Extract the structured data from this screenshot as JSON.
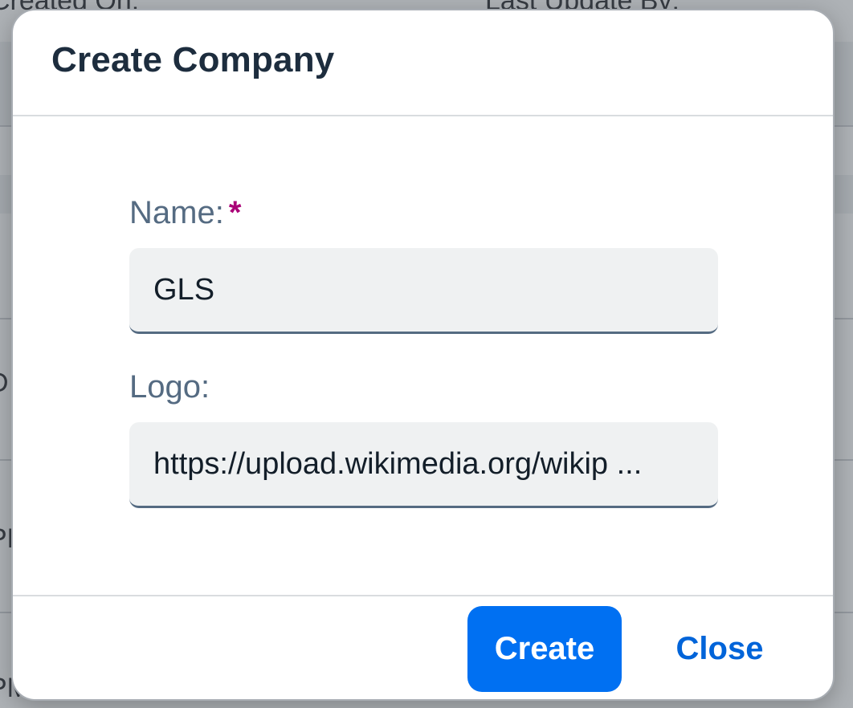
{
  "background": {
    "header_left": "Created On:",
    "header_right": "Last Update By:",
    "row_text_1": "D",
    "row_text_2": "PM",
    "row_text_3": "PM"
  },
  "dialog": {
    "title": "Create Company",
    "fields": [
      {
        "label": "Name:",
        "required_mark": "*",
        "value": "GLS"
      },
      {
        "label": "Logo:",
        "value": "https://upload.wikimedia.org/wikip ..."
      }
    ],
    "buttons": {
      "create_label": "Create",
      "close_label": "Close"
    }
  },
  "colors": {
    "accent": "#0070f2",
    "link": "#0064d9",
    "required": "#aa0077",
    "title": "#1d2d3e",
    "label": "#556b82"
  }
}
